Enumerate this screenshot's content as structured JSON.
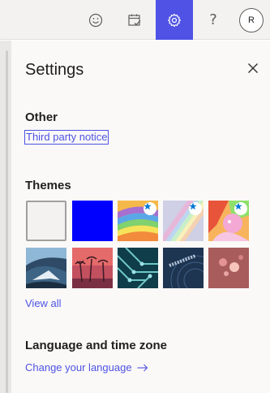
{
  "topbar": {
    "icons": [
      "emoji-icon",
      "calendar-check-icon",
      "gear-icon",
      "help-icon"
    ],
    "help_glyph": "?",
    "avatar_initial": "R",
    "accent_color": "#4f52e4"
  },
  "settings": {
    "title": "Settings",
    "other": {
      "heading": "Other",
      "third_party_link": "Third party notice"
    },
    "themes": {
      "heading": "Themes",
      "tiles": [
        {
          "name": "light-gray",
          "selected": true,
          "starred": false
        },
        {
          "name": "blue",
          "selected": false,
          "starred": false
        },
        {
          "name": "rainbow",
          "selected": false,
          "starred": true
        },
        {
          "name": "pastel-rainbow",
          "selected": false,
          "starred": true
        },
        {
          "name": "unicorn",
          "selected": false,
          "starred": true
        },
        {
          "name": "mountain",
          "selected": false,
          "starred": false
        },
        {
          "name": "palms",
          "selected": false,
          "starred": false
        },
        {
          "name": "circuit",
          "selected": false,
          "starred": false
        },
        {
          "name": "innovation",
          "selected": false,
          "starred": false
        },
        {
          "name": "bokeh",
          "selected": false,
          "starred": false
        }
      ],
      "view_all": "View all"
    },
    "language": {
      "heading": "Language and time zone",
      "change_link": "Change your language"
    }
  }
}
